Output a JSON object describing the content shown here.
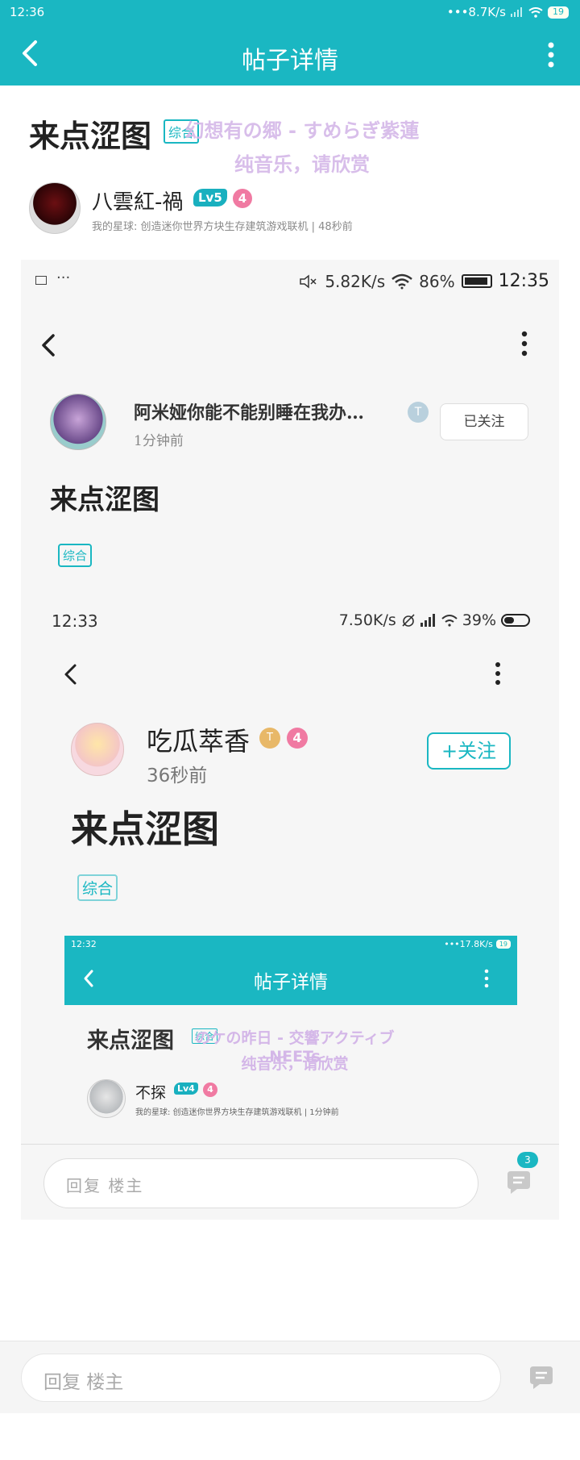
{
  "status_bar": {
    "time": "12:36",
    "network": "•••8.7K/s",
    "battery": "19"
  },
  "nav": {
    "title": "帖子详情"
  },
  "post": {
    "title": "来点涩图",
    "tag": "综合",
    "music_song": "幻想有の郷 - すめらぎ紫蓮",
    "music_sub": "纯音乐，请欣赏",
    "author": {
      "name": "八雲紅-禍",
      "level": "Lv5",
      "badge_num": "4",
      "meta": "我的星球: 创造迷你世界方块生存建筑游戏联机 | 48秒前"
    }
  },
  "shot1": {
    "status_dots": "···",
    "status_speed": "5.82K/s",
    "status_battery_pct": "86%",
    "status_time": "12:35",
    "author": "阿米娅你能不能别睡在我办…",
    "tbadge": "T",
    "time": "1分钟前",
    "follow_label": "已关注",
    "title": "来点涩图",
    "tag": "综合",
    "reply_placeholder": "回复  楼主",
    "comment_count": "3"
  },
  "shot2": {
    "status_time": "12:33",
    "status_speed": "7.50K/s",
    "status_battery_pct": "39%",
    "author": "吃瓜萃香",
    "tbadge": "T",
    "badge_num": "4",
    "time": "36秒前",
    "follow_label": "+关注",
    "title": "来点涩图",
    "tag": "综合"
  },
  "shot3": {
    "status_time": "12:32",
    "status_speed": "•••17.8K/s",
    "battery": "19",
    "nav_title": "帖子详情",
    "title": "来点涩图",
    "tag": "综合",
    "music_song": "のケの昨日 - 交響アクティブNEETs",
    "music_sub": "纯音乐，请欣赏",
    "author": "不探",
    "level": "Lv4",
    "badge_num": "4",
    "meta": "我的星球: 创造迷你世界方块生存建筑游戏联机 | 1分钟前"
  },
  "reply": {
    "placeholder": "回复 楼主"
  },
  "colors": {
    "accent": "#1ab7c2",
    "badge_pink": "#f07aa2",
    "music_overlay": "#d4b7e8"
  },
  "icons": [
    "back-icon",
    "more-icon",
    "wifi-icon",
    "signal-icon",
    "battery-icon",
    "comment-icon",
    "mute-icon",
    "image-icon"
  ]
}
